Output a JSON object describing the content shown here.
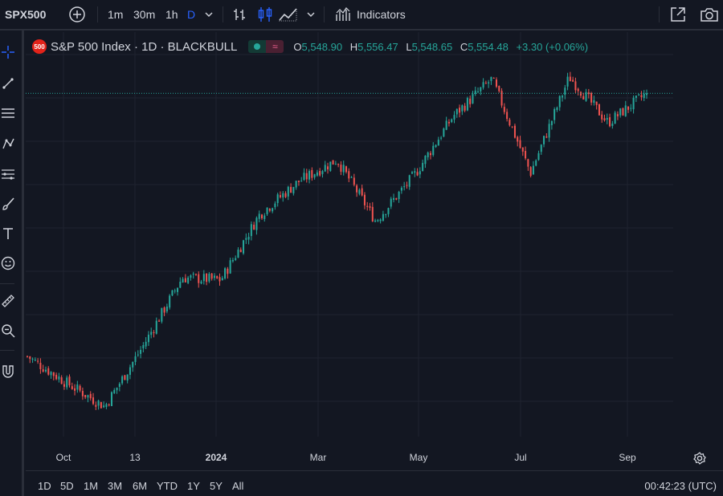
{
  "toolbar": {
    "symbol": "SPX500",
    "add_symbol_icon": "plus-circle-icon",
    "intervals": [
      "1m",
      "30m",
      "1h",
      "D"
    ],
    "active_interval": "D",
    "indicators_label": "Indicators",
    "colors": {
      "active": "#2962ff",
      "text": "#d1d4dc"
    }
  },
  "legend": {
    "badge": "500",
    "title": "S&P 500 Index · 1D · BLACKBULL",
    "open_key": "O",
    "open": "5,548.90",
    "high_key": "H",
    "high": "5,556.47",
    "low_key": "L",
    "low": "5,548.65",
    "close_key": "C",
    "close": "5,554.48",
    "change": "+3.30 (+0.06%)"
  },
  "left_tools": [
    "crosshair-icon",
    "trend-line-icon",
    "horizontal-lines-icon",
    "pattern-icon",
    "fib-icon",
    "brush-icon",
    "text-icon",
    "emoji-icon",
    "ruler-icon",
    "zoom-icon",
    "magnet-icon"
  ],
  "x_axis": {
    "labels": [
      "Oct",
      "13",
      "2024",
      "Mar",
      "May",
      "Jul",
      "Sep"
    ]
  },
  "bottom": {
    "ranges": [
      "1D",
      "5D",
      "1M",
      "3M",
      "6M",
      "YTD",
      "1Y",
      "5Y",
      "All"
    ],
    "clock": "00:42:23 (UTC)"
  },
  "chart_data": {
    "type": "candlestick",
    "symbol": "S&P 500 Index",
    "interval": "1D",
    "colors": {
      "up": "#26a69a",
      "down": "#ef5350",
      "last_price_line": "#26a69a"
    },
    "last_close": 5554.48,
    "approx_close_path": [
      {
        "time": "start",
        "close": 4350
      },
      {
        "time": "Oct",
        "close": 4230
      },
      {
        "time": "late Oct",
        "close": 4120
      },
      {
        "time": "13",
        "close": 4400
      },
      {
        "time": "Dec",
        "close": 4710
      },
      {
        "time": "2024",
        "close": 4700
      },
      {
        "time": "Feb",
        "close": 5000
      },
      {
        "time": "Mar",
        "close": 5150
      },
      {
        "time": "late Mar",
        "close": 5250
      },
      {
        "time": "Apr dip",
        "close": 4970
      },
      {
        "time": "May",
        "close": 5180
      },
      {
        "time": "Jun",
        "close": 5450
      },
      {
        "time": "Jul",
        "close": 5620
      },
      {
        "time": "early Aug dip",
        "close": 5190
      },
      {
        "time": "late Aug",
        "close": 5630
      },
      {
        "time": "Sep",
        "close": 5420
      },
      {
        "time": "end",
        "close": 5554.48
      }
    ]
  }
}
